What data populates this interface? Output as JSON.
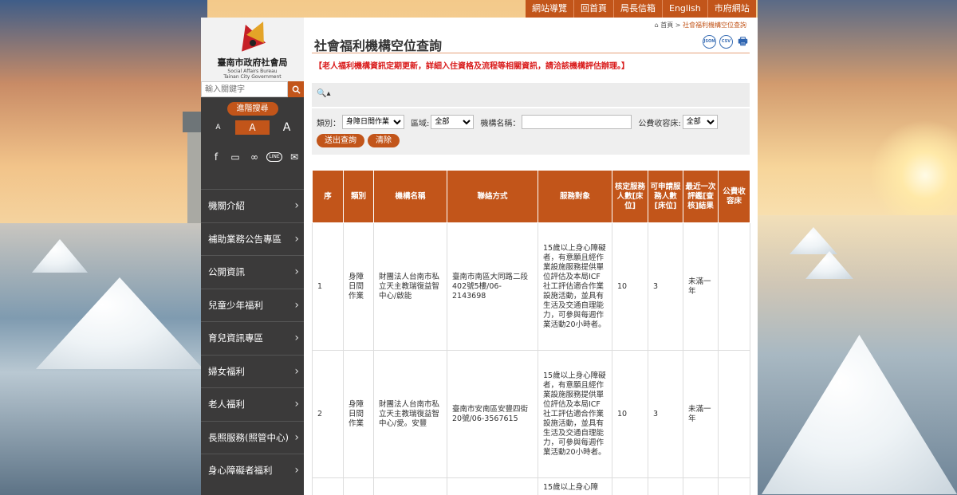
{
  "topnav": [
    "網站導覽",
    "回首頁",
    "局長信箱",
    "English",
    "市府網站"
  ],
  "logo": {
    "title": "臺南市政府社會局",
    "en1": "Social Affairs Bureau",
    "en2": "Tainan City Government"
  },
  "search": {
    "placeholder": "輸入關鍵字"
  },
  "sidebar": {
    "advanced_search": "進階搜尋",
    "font_sizes": [
      "A",
      "A",
      "A"
    ],
    "menu": [
      "機關介紹",
      "補助業務公告專區",
      "公開資訊",
      "兒童少年福利",
      "育兒資訊專區",
      "婦女福利",
      "老人福利",
      "長照服務(照管中心)",
      "身心障礙者福利"
    ]
  },
  "breadcrumb": {
    "home": "首頁",
    "sep": ">",
    "current": "社會福利機構空位查詢"
  },
  "page": {
    "title": "社會福利機構空位查詢",
    "notice": "【老人福利機構資訊定期更新，詳細入住資格及流程等相關資訊，請洽該機構評估辦理。】",
    "tools": [
      "JSON",
      "CSV",
      "print-icon"
    ]
  },
  "filter": {
    "toggle": "🔍▴",
    "type_label": "類別：",
    "type_value": "身障日間作業",
    "area_label": "區域:",
    "area_value": "全部",
    "name_label": "機構名稱：",
    "bed_label": "公費收容床:",
    "bed_value": "全部",
    "submit": "送出查詢",
    "clear": "清除"
  },
  "table": {
    "headers": [
      "序",
      "類別",
      "機構名稱",
      "聯絡方式",
      "服務對象",
      "核定服務人數[床位]",
      "可申請服務人數[床位]",
      "最近一次評鑑[查核]結果",
      "公費收容床"
    ],
    "rows": [
      {
        "no": "1",
        "type": "身障日間作業",
        "name": "財團法人台南市私立天主教瑞復益智中心/啟能",
        "contact": "臺南市南區大同路二段402號5樓/06-2143698",
        "target": "15歲以上身心障礙者，有意願且經作業設施服務提供單位評估及本局ICF社工評估適合作業設施活動，並具有生活及交通自理能力，可參與每週作業活動20小時者。",
        "approved": "10",
        "available": "3",
        "eval": "未滿一年",
        "public_bed": ""
      },
      {
        "no": "2",
        "type": "身障日間作業",
        "name": "財團法人台南市私立天主教瑞復益智中心/愛。安豐",
        "contact": "臺南市安南區安豐四街20號/06-3567615",
        "target": "15歲以上身心障礙者，有意願且經作業設施服務提供單位評估及本局ICF社工評估適合作業設施活動，並具有生活及交通自理能力，可參與每週作業活動20小時者。",
        "approved": "10",
        "available": "3",
        "eval": "未滿一年",
        "public_bed": ""
      },
      {
        "no": "",
        "type": "",
        "name": "",
        "contact": "",
        "target": "15歲以上身心障",
        "approved": "",
        "available": "",
        "eval": "",
        "public_bed": ""
      }
    ]
  }
}
